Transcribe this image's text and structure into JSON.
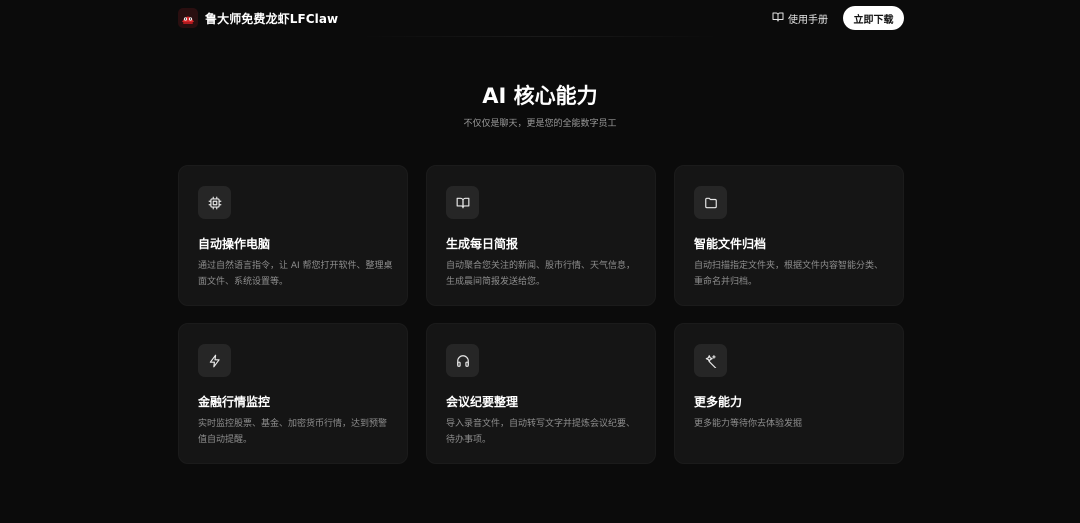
{
  "header": {
    "brand_name": "鲁大师免费龙虾LFClaw",
    "manual_label": "使用手册",
    "download_label": "立即下载"
  },
  "section": {
    "title": "AI 核心能力",
    "subtitle": "不仅仅是聊天，更是您的全能数字员工"
  },
  "features": [
    {
      "icon": "cpu-icon",
      "title": "自动操作电脑",
      "desc": "通过自然语言指令，让 AI 帮您打开软件、整理桌面文件、系统设置等。"
    },
    {
      "icon": "book-icon",
      "title": "生成每日简报",
      "desc": "自动聚合您关注的新闻、股市行情、天气信息，生成晨间简报发送给您。"
    },
    {
      "icon": "folder-icon",
      "title": "智能文件归档",
      "desc": "自动扫描指定文件夹，根据文件内容智能分类、重命名并归档。"
    },
    {
      "icon": "lightning-icon",
      "title": "金融行情监控",
      "desc": "实时监控股票、基金、加密货币行情，达到预警值自动提醒。"
    },
    {
      "icon": "headphones-icon",
      "title": "会议纪要整理",
      "desc": "导入录音文件，自动转写文字并提炼会议纪要、待办事项。"
    },
    {
      "icon": "sparkle-wand-icon",
      "title": "更多能力",
      "desc": "更多能力等待你去体验发掘"
    }
  ],
  "colors": {
    "background": "#0b0b0b",
    "card": "#151515",
    "icon_tile": "#262626",
    "button": "#ffffff"
  }
}
